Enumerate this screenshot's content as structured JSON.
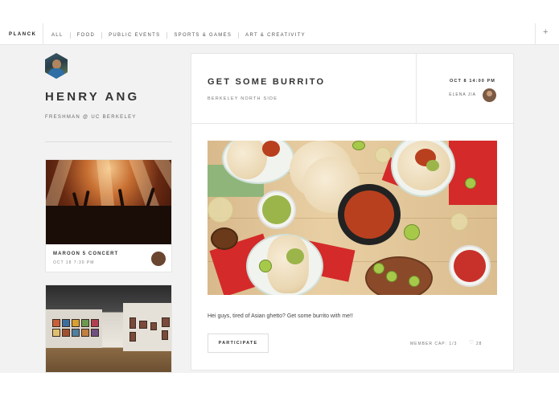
{
  "nav": {
    "brand": "PLANCK",
    "items": [
      "ALL",
      "FOOD",
      "PUBLIC EVENTS",
      "SPORTS & GAMES",
      "ART & CREATIVITY"
    ],
    "add_icon": "plus-icon"
  },
  "profile": {
    "name": "HENRY ANG",
    "subtitle": "FRESHMAN @ UC BERKELEY"
  },
  "cards": [
    {
      "title": "MAROON 5 CONCERT",
      "date": "OCT 18 7:30 PM",
      "image": "concert-crowd-photo"
    },
    {
      "title": "",
      "date": "",
      "image": "art-gallery-photo"
    }
  ],
  "post": {
    "title": "GET SOME BURRITO",
    "location": "BERKELEY NORTH SIDE",
    "time": "OCT 8 14:00 PM",
    "host": "ELENA JIA",
    "image": "burrito-food-spread-photo",
    "text": "Hei guys, tired of Asian ghetto? Get some burrito with me!!",
    "participate_label": "PARTICIPATE",
    "member_cap": "MEMBER CAP: 1/3",
    "likes": "28"
  }
}
